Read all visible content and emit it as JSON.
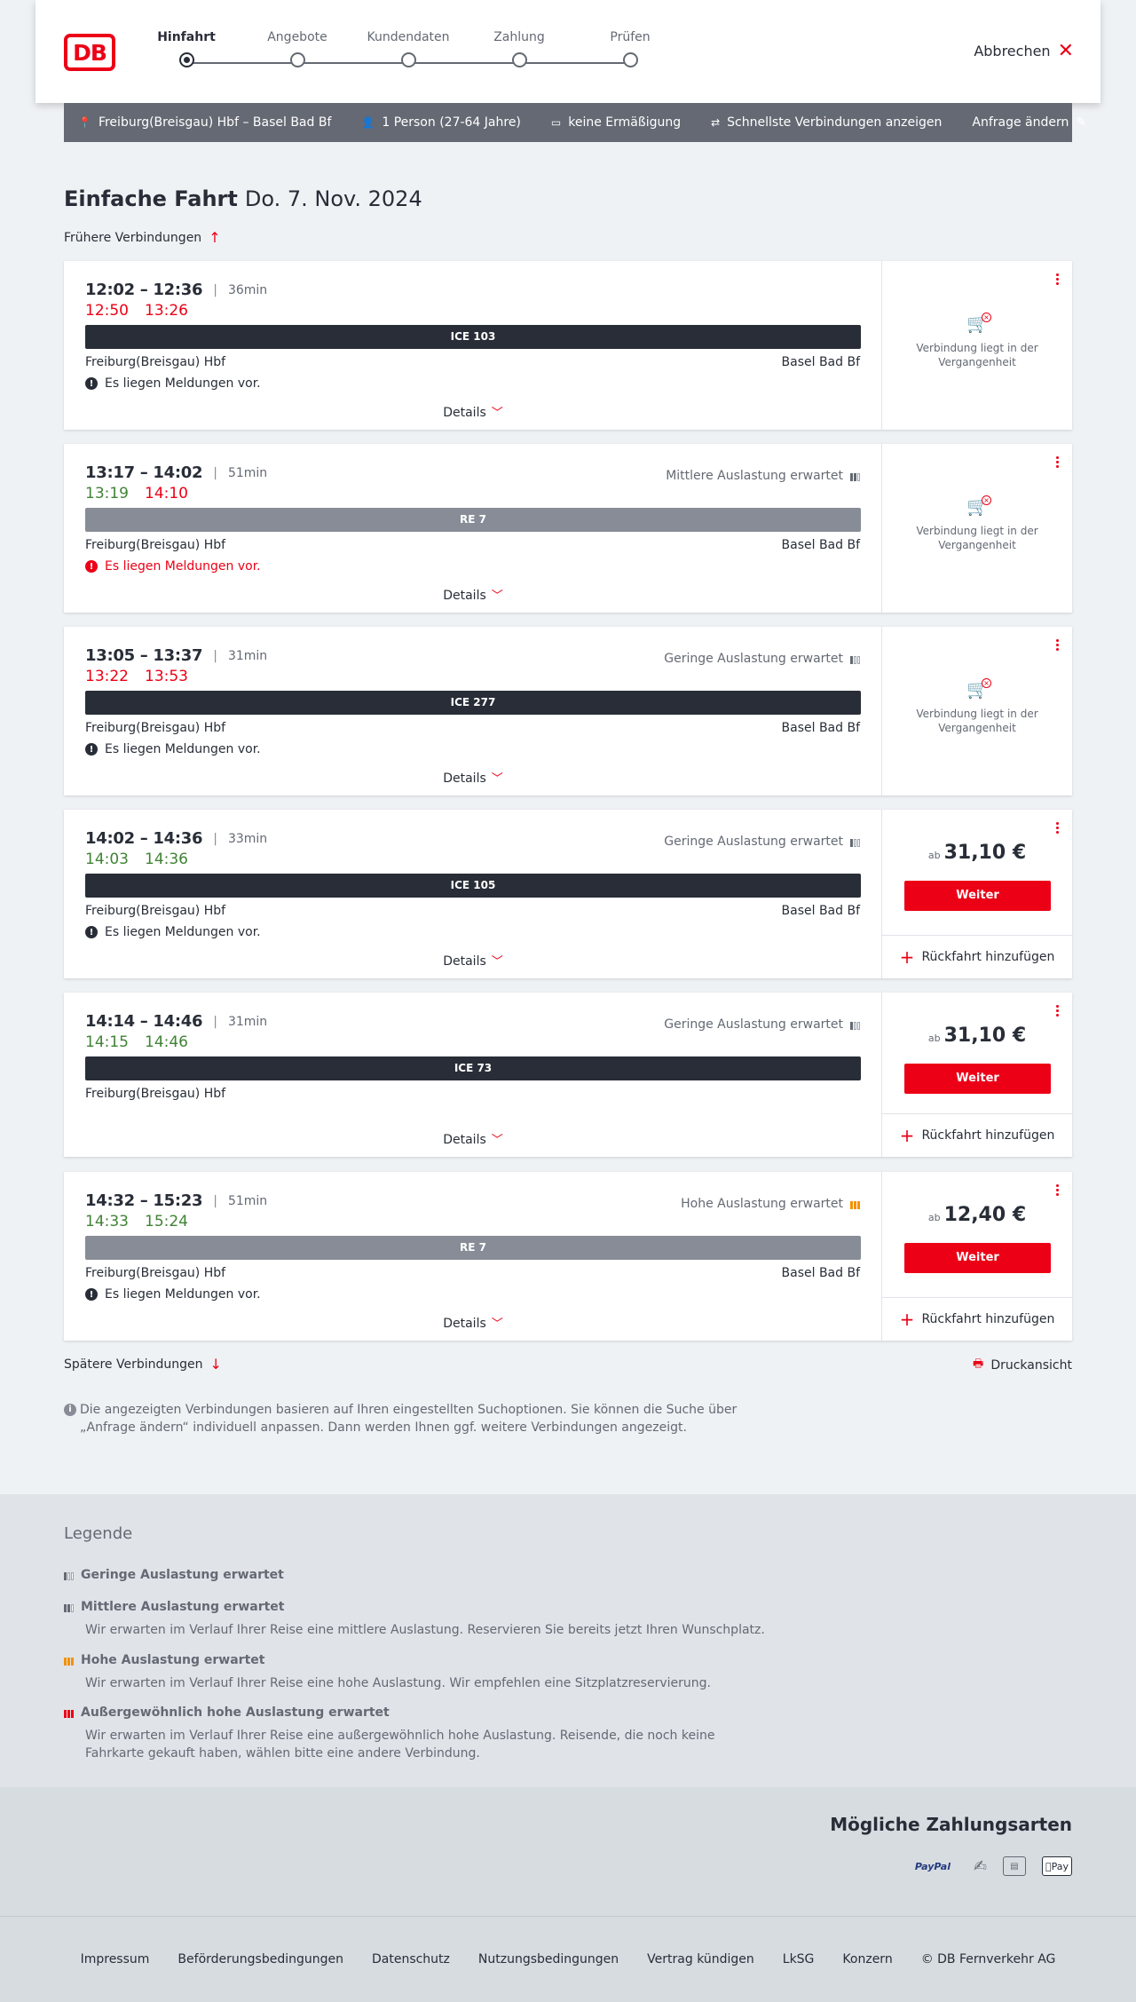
{
  "header": {
    "logo": "DB",
    "steps": [
      "Hinfahrt",
      "Angebote",
      "Kundendaten",
      "Zahlung",
      "Prüfen"
    ],
    "active_step": 0,
    "cancel_label": "Abbrechen"
  },
  "summary": {
    "route": "Freiburg(Breisgau) Hbf – Basel Bad Bf",
    "persons": "1 Person (27-64 Jahre)",
    "discount": "keine Ermäßigung",
    "fastest": "Schnellste Verbindungen anzeigen",
    "change": "Anfrage ändern"
  },
  "title": {
    "trip": "Einfache Fahrt",
    "date": "Do. 7. Nov. 2024"
  },
  "earlier_label": "Frühere Verbindungen",
  "later_label": "Spätere Verbindungen",
  "print_label": "Druckansicht",
  "details_label": "Details",
  "past_label": "Verbindung liegt in der Vergangenheit",
  "weiter_label": "Weiter",
  "return_label": "Rückfahrt hinzufügen",
  "price_prefix": "ab",
  "connections": [
    {
      "times": "12:02 – 12:36",
      "duration": "36min",
      "rt_dep": "12:50",
      "rt_arr": "13:26",
      "rt_status": "red",
      "load": "",
      "load_level": 0,
      "train": "ICE 103",
      "train_type": "ice",
      "from": "Freiburg(Breisgau) Hbf",
      "to": "Basel Bad Bf",
      "message": "Es liegen Meldungen vor.",
      "message_warn": false,
      "past": true,
      "price": ""
    },
    {
      "times": "13:17 – 14:02",
      "duration": "51min",
      "rt_dep": "13:19",
      "rt_arr": "14:10",
      "rt_status": "mixed",
      "load": "Mittlere Auslastung erwartet",
      "load_level": 2,
      "train": "RE 7",
      "train_type": "re",
      "from": "Freiburg(Breisgau) Hbf",
      "to": "Basel Bad Bf",
      "message": "Es liegen Meldungen vor.",
      "message_warn": true,
      "past": true,
      "price": ""
    },
    {
      "times": "13:05 – 13:37",
      "duration": "31min",
      "rt_dep": "13:22",
      "rt_arr": "13:53",
      "rt_status": "red",
      "load": "Geringe Auslastung erwartet",
      "load_level": 1,
      "train": "ICE 277",
      "train_type": "ice",
      "from": "Freiburg(Breisgau) Hbf",
      "to": "Basel Bad Bf",
      "message": "Es liegen Meldungen vor.",
      "message_warn": false,
      "past": true,
      "price": ""
    },
    {
      "times": "14:02 – 14:36",
      "duration": "33min",
      "rt_dep": "14:03",
      "rt_arr": "14:36",
      "rt_status": "green",
      "load": "Geringe Auslastung erwartet",
      "load_level": 1,
      "train": "ICE 105",
      "train_type": "ice",
      "from": "Freiburg(Breisgau) Hbf",
      "to": "Basel Bad Bf",
      "message": "Es liegen Meldungen vor.",
      "message_warn": false,
      "past": false,
      "price": "31,10 €"
    },
    {
      "times": "14:14 – 14:46",
      "duration": "31min",
      "rt_dep": "14:15",
      "rt_arr": "14:46",
      "rt_status": "green",
      "load": "Geringe Auslastung erwartet",
      "load_level": 1,
      "train": "ICE 73",
      "train_type": "ice",
      "from": "Freiburg(Breisgau) Hbf",
      "to": "",
      "message": "",
      "message_warn": false,
      "past": false,
      "price": "31,10 €"
    },
    {
      "times": "14:32 – 15:23",
      "duration": "51min",
      "rt_dep": "14:33",
      "rt_arr": "15:24",
      "rt_status": "green",
      "load": "Hohe Auslastung erwartet",
      "load_level": 3,
      "train": "RE 7",
      "train_type": "re",
      "from": "Freiburg(Breisgau) Hbf",
      "to": "Basel Bad Bf",
      "message": "Es liegen Meldungen vor.",
      "message_warn": false,
      "past": false,
      "price": "12,40 €"
    }
  ],
  "info_text": "Die angezeigten Verbindungen basieren auf Ihren eingestellten Suchoptionen. Sie können die Suche über „Anfrage ändern“ individuell anpassen. Dann werden Ihnen ggf. weitere Verbindungen angezeigt.",
  "legend": {
    "title": "Legende",
    "items": [
      {
        "title": "Geringe Auslastung erwartet",
        "desc": ""
      },
      {
        "title": "Mittlere Auslastung erwartet",
        "desc": "Wir erwarten im Verlauf Ihrer Reise eine mittlere Auslastung. Reservieren Sie bereits jetzt Ihren Wunschplatz."
      },
      {
        "title": "Hohe Auslastung erwartet",
        "desc": "Wir erwarten im Verlauf Ihrer Reise eine hohe Auslastung. Wir empfehlen eine Sitzplatzreservierung."
      },
      {
        "title": "Außergewöhnlich hohe Auslastung erwartet",
        "desc": "Wir erwarten im Verlauf Ihrer Reise eine außergewöhnlich hohe Auslastung. Reisende, die noch keine Fahrkarte gekauft haben, wählen bitte eine andere Verbindung."
      }
    ]
  },
  "payments": {
    "title": "Mögliche Zahlungsarten",
    "methods": [
      "PayPal",
      "credit-card-icon",
      "sepa-icon",
      "Pay"
    ]
  },
  "footer": [
    "Impressum",
    "Beförderungsbedingungen",
    "Datenschutz",
    "Nutzungsbedingungen",
    "Vertrag kündigen",
    "LkSG",
    "Konzern",
    "© DB Fernverkehr AG"
  ],
  "colors": {
    "accent": "#ec0016",
    "on_time": "#408335",
    "dark": "#282d37",
    "high_load": "#f39200"
  }
}
